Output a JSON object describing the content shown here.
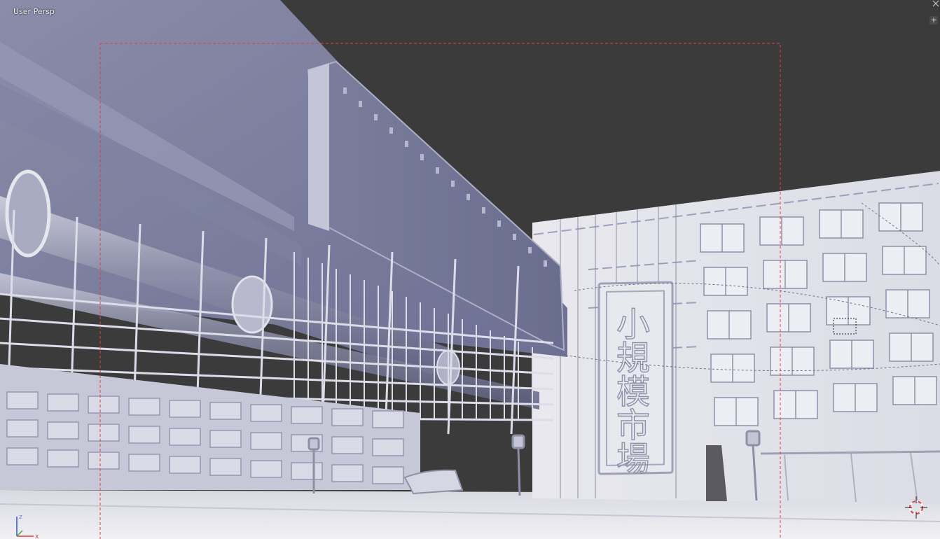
{
  "viewport": {
    "view_label": "User Persp",
    "add_region_button": "+",
    "sign_text": "小規模市場"
  },
  "axis_gizmo": {
    "x_label": "x",
    "z_label": "z"
  },
  "colors": {
    "background": "#3b3b3b",
    "camera_frame": "#e04040",
    "axis_x": "#d04040",
    "axis_z": "#3050e0"
  }
}
